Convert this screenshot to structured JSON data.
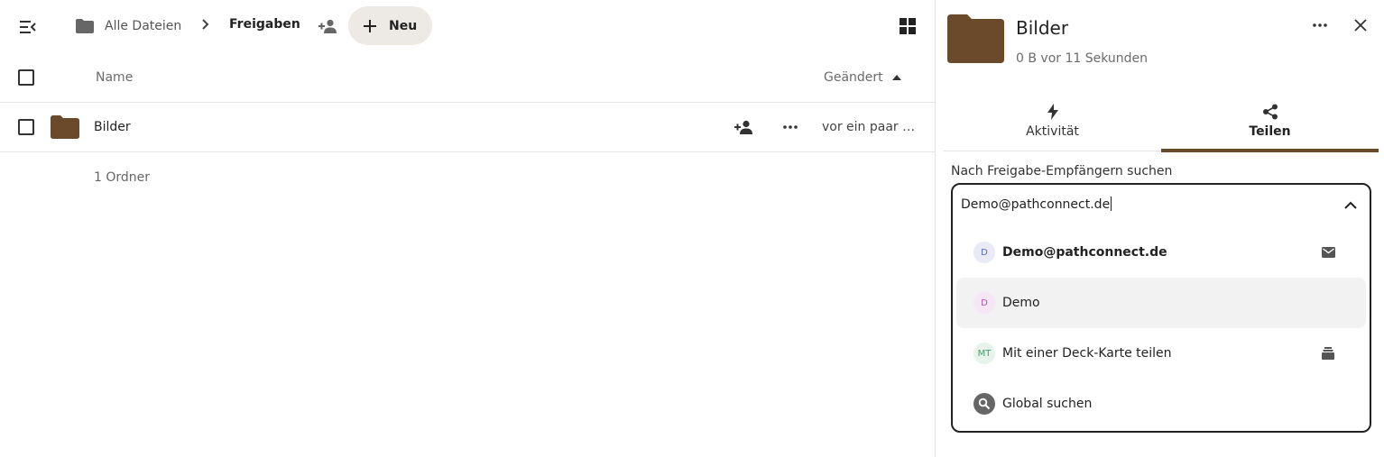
{
  "topbar": {
    "breadcrumb_home": "Alle Dateien",
    "breadcrumb_current": "Freigaben",
    "new_button": "Neu"
  },
  "list": {
    "header_name": "Name",
    "header_modified": "Geändert",
    "rows": [
      {
        "name": "Bilder",
        "modified": "vor ein paar Sekunden"
      }
    ],
    "summary": "1 Ordner"
  },
  "sidebar": {
    "title": "Bilder",
    "subtitle": "0 B vor 11 Sekunden",
    "tabs": [
      {
        "label": "Aktivität",
        "icon": "activity-bolt-icon"
      },
      {
        "label": "Teilen",
        "icon": "share-icon",
        "active": true
      }
    ],
    "search_label": "Nach Freigabe-Empfängern suchen",
    "search_value": "Demo@pathconnect.de",
    "options": [
      {
        "avatar": "D",
        "label": "Demo@pathconnect.de",
        "icon": "email-icon"
      },
      {
        "avatar": "D",
        "label": "Demo"
      },
      {
        "avatar": "MT",
        "label": "Mit einer Deck-Karte teilen",
        "icon": "deck-icon"
      },
      {
        "avatar": "",
        "label": "Global suchen",
        "icon": "search-icon"
      }
    ]
  },
  "colors": {
    "folder": "#6b4a2b",
    "accent": "#6b4a2b",
    "new_button_bg": "#ede9e5",
    "hover_bg": "#f2f2f2"
  }
}
